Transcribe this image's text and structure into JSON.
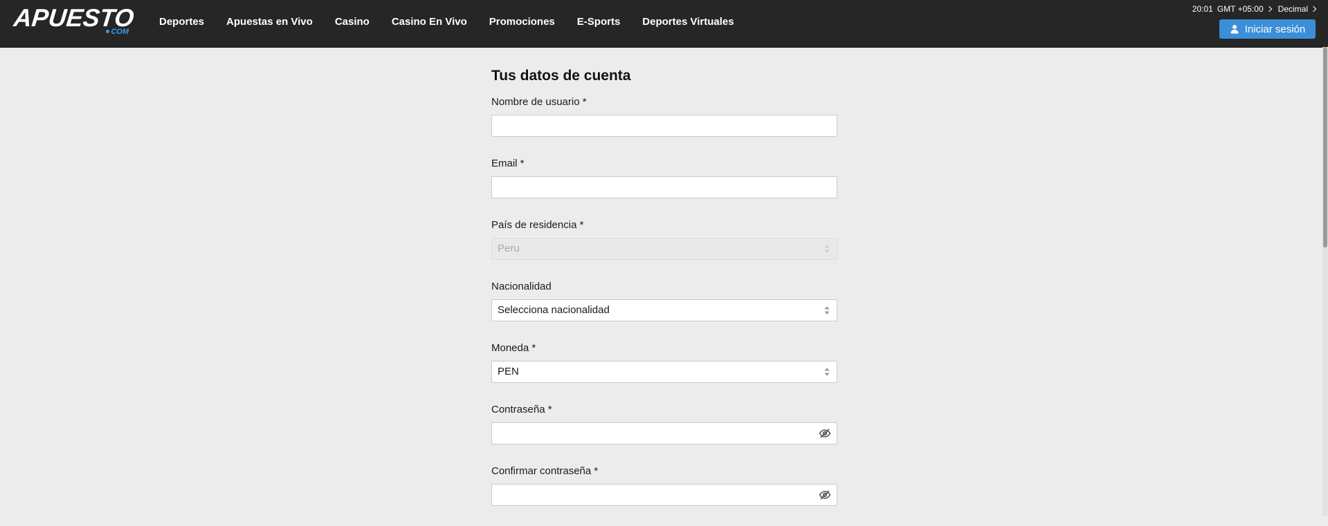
{
  "header": {
    "logo": {
      "main": "APUESTO",
      "sub": "COM"
    },
    "nav": [
      "Deportes",
      "Apuestas en Vivo",
      "Casino",
      "Casino En Vivo",
      "Promociones",
      "E-Sports",
      "Deportes Virtuales"
    ],
    "time": "20:01",
    "timezone": "GMT +05:00",
    "odds_format": "Decimal",
    "login_label": "Iniciar sesión"
  },
  "form": {
    "title": "Tus datos de cuenta",
    "fields": [
      {
        "label": "Nombre de usuario *",
        "type": "text",
        "value": ""
      },
      {
        "label": "Email *",
        "type": "text",
        "value": ""
      },
      {
        "label": "País de residencia *",
        "type": "select",
        "value": "Peru",
        "disabled": true
      },
      {
        "label": "Nacionalidad",
        "type": "select",
        "value": "Selecciona nacionalidad"
      },
      {
        "label": "Moneda *",
        "type": "select",
        "value": "PEN"
      },
      {
        "label": "Contraseña *",
        "type": "password",
        "value": ""
      },
      {
        "label": "Confirmar contraseña *",
        "type": "password",
        "value": ""
      }
    ]
  },
  "icons": {
    "user": "user-icon",
    "chevron": "chevron-right-icon",
    "select_arrows": "select-updown-icon",
    "password_toggle": "eye-off-icon"
  },
  "colors": {
    "header_bg": "#262626",
    "page_bg": "#ececec",
    "accent": "#3b8fd9",
    "logo_accent": "#3b9be8"
  }
}
